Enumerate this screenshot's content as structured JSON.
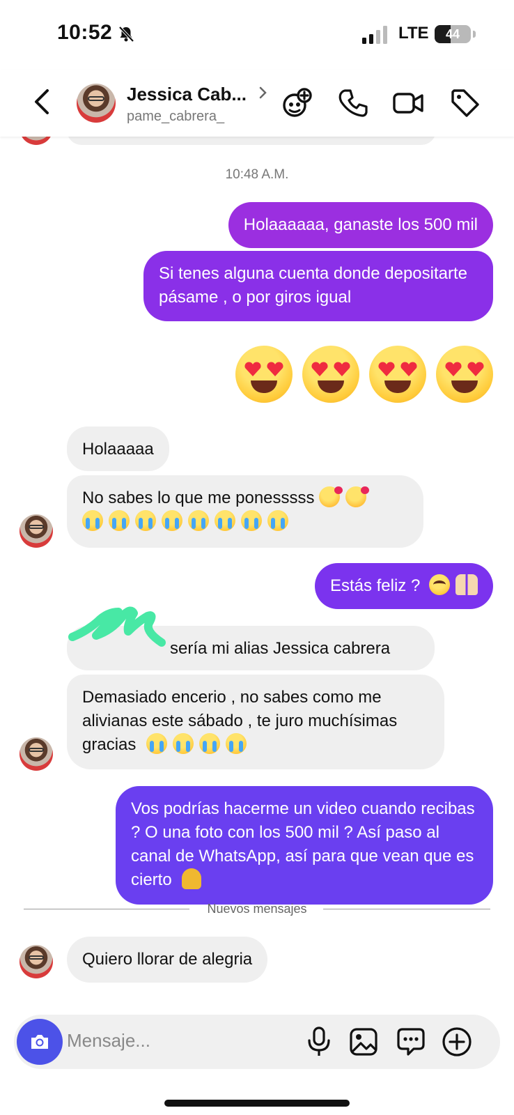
{
  "status": {
    "time": "10:52",
    "network": "LTE",
    "battery": "44",
    "battery_level": 0.44
  },
  "header": {
    "name": "Jessica Cab...",
    "username": "pame_cabrera_",
    "icons": [
      "back-chevron-icon",
      "add-person-icon",
      "phone-icon",
      "video-camera-icon",
      "tag-icon"
    ]
  },
  "chat": {
    "timestamp": "10:48 A.M.",
    "messages": [
      {
        "dir": "out",
        "text": "Holaaaaaa, ganaste los 500 mil"
      },
      {
        "dir": "out",
        "text": "Si tenes alguna cuenta donde depositarte pásame , o por giros igual"
      },
      {
        "dir": "out",
        "emoji": "heart-eyes x4"
      },
      {
        "dir": "in",
        "text": "Holaaaaa"
      },
      {
        "dir": "in",
        "text": "No sabes lo que me ponesssss"
      },
      {
        "dir": "out",
        "text": "Estás feliz ?"
      },
      {
        "dir": "in",
        "text": "sería mi alias Jessica cabrera"
      },
      {
        "dir": "in",
        "text": "Demasiado encerio , no sabes como me alivianas este sábado , te juro muchísimas gracias"
      },
      {
        "dir": "out",
        "text": "Vos podrías hacerme un video cuando recibas ? O una foto con los 500 mil ? Así paso al canal de WhatsApp, así para que vean que es cierto"
      },
      {
        "dir": "in",
        "text": "Quiero llorar de alegria"
      }
    ],
    "new_messages_label": "Nuevos mensajes"
  },
  "composer": {
    "placeholder": "Mensaje...",
    "icons": [
      "camera-icon",
      "microphone-icon",
      "image-icon",
      "sticker-icon",
      "plus-icon"
    ]
  },
  "colors": {
    "out_top": "#9b2fe0",
    "out_mid": "#7b33ee",
    "out_bottom": "#6a3ff0",
    "in": "#efefef",
    "camera": "#4c52e8"
  }
}
